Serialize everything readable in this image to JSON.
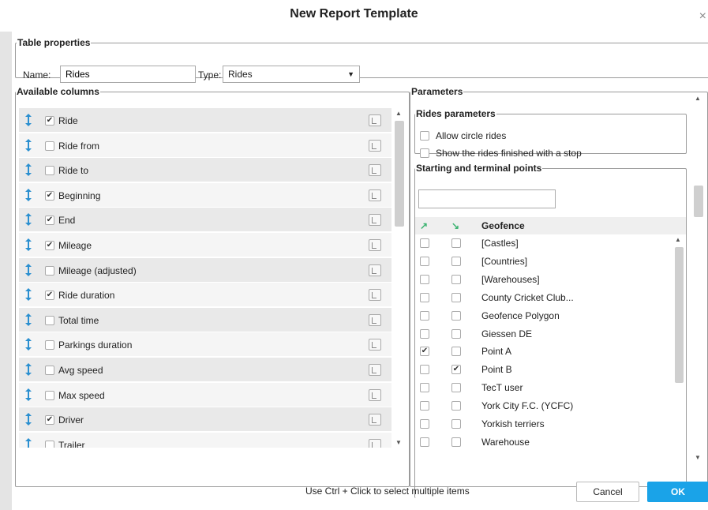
{
  "dialog": {
    "title": "New Report Template",
    "close_glyph": "×"
  },
  "table_properties": {
    "legend": "Table properties",
    "name_label": "Name:",
    "name_value": "Rides",
    "type_label": "Type:",
    "type_value": "Rides",
    "type_arrow": "▼"
  },
  "available_columns": {
    "legend": "Available columns",
    "drag_icon": "vertical-arrows-icon",
    "settings_icon": "column-settings-icon",
    "items": [
      {
        "label": "Ride",
        "checked": true
      },
      {
        "label": "Ride from",
        "checked": false
      },
      {
        "label": "Ride to",
        "checked": false
      },
      {
        "label": "Beginning",
        "checked": true
      },
      {
        "label": "End",
        "checked": true
      },
      {
        "label": "Mileage",
        "checked": true
      },
      {
        "label": "Mileage (adjusted)",
        "checked": false
      },
      {
        "label": "Ride duration",
        "checked": true
      },
      {
        "label": "Total time",
        "checked": false
      },
      {
        "label": "Parkings duration",
        "checked": false
      },
      {
        "label": "Avg speed",
        "checked": false
      },
      {
        "label": "Max speed",
        "checked": false
      },
      {
        "label": "Driver",
        "checked": true
      },
      {
        "label": "Trailer",
        "checked": false
      }
    ]
  },
  "parameters": {
    "legend": "Parameters",
    "rides_parameters": {
      "legend": "Rides parameters",
      "options": [
        {
          "label": "Allow circle rides",
          "checked": false
        },
        {
          "label": "Show the rides finished with a stop",
          "checked": false
        }
      ]
    },
    "start_terminal": {
      "legend": "Starting and terminal points",
      "search_value": "",
      "header": {
        "start_icon": "start-point-icon",
        "end_icon": "end-point-icon",
        "name": "Geofence"
      },
      "geofences": [
        {
          "name": "[Castles]",
          "start": false,
          "end": false
        },
        {
          "name": "[Countries]",
          "start": false,
          "end": false
        },
        {
          "name": "[Warehouses]",
          "start": false,
          "end": false
        },
        {
          "name": "County Cricket Club...",
          "start": false,
          "end": false
        },
        {
          "name": "Geofence Polygon",
          "start": false,
          "end": false
        },
        {
          "name": "Giessen DE",
          "start": false,
          "end": false
        },
        {
          "name": "Point A",
          "start": true,
          "end": false
        },
        {
          "name": "Point B",
          "start": false,
          "end": true
        },
        {
          "name": "TecT user",
          "start": false,
          "end": false
        },
        {
          "name": "York City F.C. (YCFC)",
          "start": false,
          "end": false
        },
        {
          "name": "Yorkish terriers",
          "start": false,
          "end": false
        },
        {
          "name": "Warehouse",
          "start": false,
          "end": false
        }
      ]
    }
  },
  "footer": {
    "hint": "Use Ctrl + Click to select multiple items",
    "cancel_label": "Cancel",
    "ok_label": "OK"
  },
  "colors": {
    "accent": "#1aa3e8",
    "drag_icon": "#2a8fd0",
    "geo_icon": "#3cb371"
  }
}
